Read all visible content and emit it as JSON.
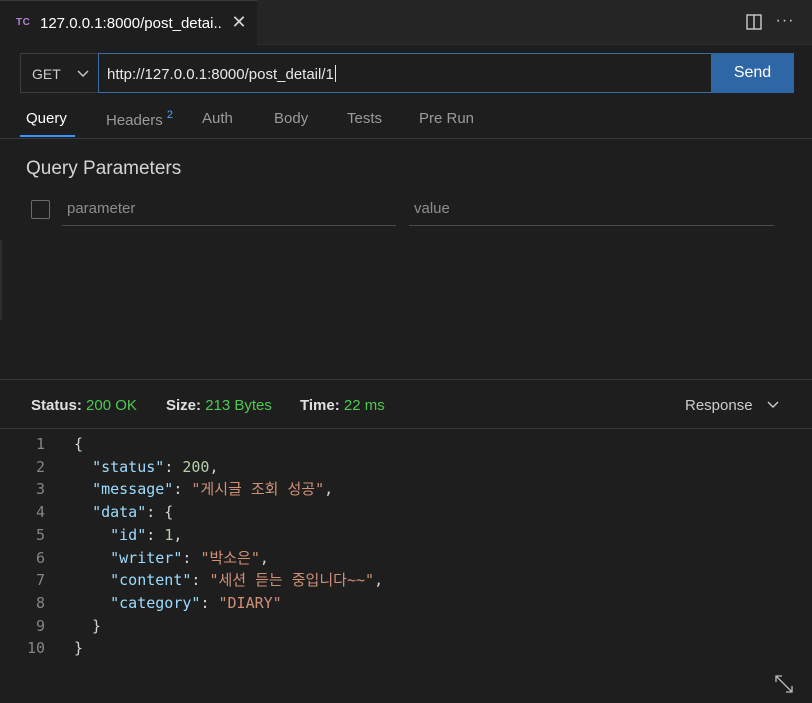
{
  "tab": {
    "badge": "TC",
    "title": "127.0.0.1:8000/post_detai..",
    "close": "✕",
    "more": "···"
  },
  "request": {
    "method": "GET",
    "url": "http://127.0.0.1:8000/post_detail/1",
    "send_label": "Send"
  },
  "req_tabs": [
    {
      "label": "Query"
    },
    {
      "label": "Headers",
      "badge": "2"
    },
    {
      "label": "Auth"
    },
    {
      "label": "Body"
    },
    {
      "label": "Tests"
    },
    {
      "label": "Pre Run"
    }
  ],
  "query": {
    "title": "Query Parameters",
    "param_placeholder": "parameter",
    "value_placeholder": "value"
  },
  "response": {
    "status_key": "Status:",
    "status_val": "200 OK",
    "size_key": "Size:",
    "size_val": "213 Bytes",
    "time_key": "Time:",
    "time_val": "22 ms",
    "view_label": "Response"
  },
  "body_lines": [
    {
      "n": "1",
      "t": [
        [
          "p",
          "{"
        ]
      ]
    },
    {
      "n": "2",
      "t": [
        [
          "p",
          "  "
        ],
        [
          "k",
          "\"status\""
        ],
        [
          "p",
          ": "
        ],
        [
          "n",
          "200"
        ],
        [
          "p",
          ","
        ]
      ]
    },
    {
      "n": "3",
      "t": [
        [
          "p",
          "  "
        ],
        [
          "k",
          "\"message\""
        ],
        [
          "p",
          ": "
        ],
        [
          "s",
          "\"게시글 조회 성공\""
        ],
        [
          "p",
          ","
        ]
      ]
    },
    {
      "n": "4",
      "t": [
        [
          "p",
          "  "
        ],
        [
          "k",
          "\"data\""
        ],
        [
          "p",
          ": {"
        ]
      ]
    },
    {
      "n": "5",
      "t": [
        [
          "p",
          "    "
        ],
        [
          "k",
          "\"id\""
        ],
        [
          "p",
          ": "
        ],
        [
          "n",
          "1"
        ],
        [
          "p",
          ","
        ]
      ]
    },
    {
      "n": "6",
      "t": [
        [
          "p",
          "    "
        ],
        [
          "k",
          "\"writer\""
        ],
        [
          "p",
          ": "
        ],
        [
          "s",
          "\"박소은\""
        ],
        [
          "p",
          ","
        ]
      ]
    },
    {
      "n": "7",
      "t": [
        [
          "p",
          "    "
        ],
        [
          "k",
          "\"content\""
        ],
        [
          "p",
          ": "
        ],
        [
          "s",
          "\"세션 듣는 중입니다~~\""
        ],
        [
          "p",
          ","
        ]
      ]
    },
    {
      "n": "8",
      "t": [
        [
          "p",
          "    "
        ],
        [
          "k",
          "\"category\""
        ],
        [
          "p",
          ": "
        ],
        [
          "s",
          "\"DIARY\""
        ]
      ]
    },
    {
      "n": "9",
      "t": [
        [
          "p",
          "  }"
        ]
      ]
    },
    {
      "n": "10",
      "t": [
        [
          "p",
          "}"
        ]
      ]
    }
  ]
}
